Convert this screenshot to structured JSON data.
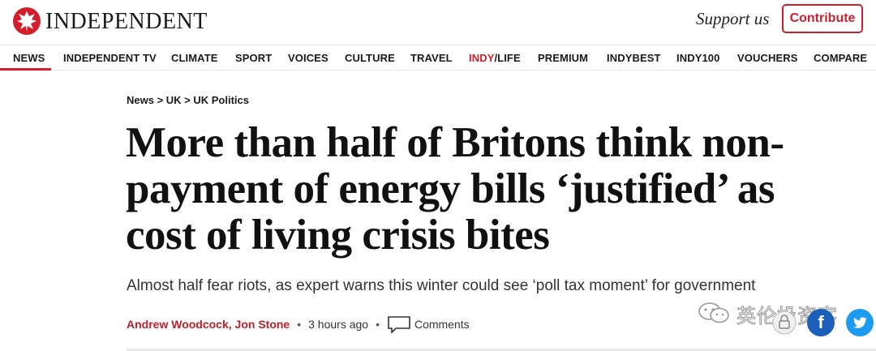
{
  "brand": {
    "name": "INDEPENDENT",
    "accent_color": "#d31e2c"
  },
  "header": {
    "support_text": "Support us",
    "contribute_label": "Contribute"
  },
  "nav": {
    "items": [
      "NEWS",
      "INDEPENDENT TV",
      "CLIMATE",
      "SPORT",
      "VOICES",
      "CULTURE",
      "TRAVEL",
      "INDY/LIFE",
      "PREMIUM",
      "INDYBEST",
      "INDY100",
      "VOUCHERS",
      "COMPARE"
    ],
    "indy_part": "INDY",
    "life_part": "/LIFE",
    "active": "NEWS"
  },
  "article": {
    "breadcrumb": "News > UK > UK Politics",
    "headline_lines": [
      "More than half of Britons think non-",
      "payment of energy bills ‘justified’ as",
      "cost of living crisis bites"
    ],
    "standfirst": "Almost half fear riots, as expert warns this winter could see ‘poll tax moment’ for government",
    "authors": [
      "Andrew Woodcock",
      "Jon Stone"
    ],
    "author_separator": ",",
    "bullet": "•",
    "time_ago": "3 hours ago",
    "comments_label": "Comments"
  },
  "social": {
    "facebook_glyph": "f",
    "twitter_icon": "twitter-bird-icon"
  },
  "watermark": {
    "text": "英伦投资客"
  }
}
